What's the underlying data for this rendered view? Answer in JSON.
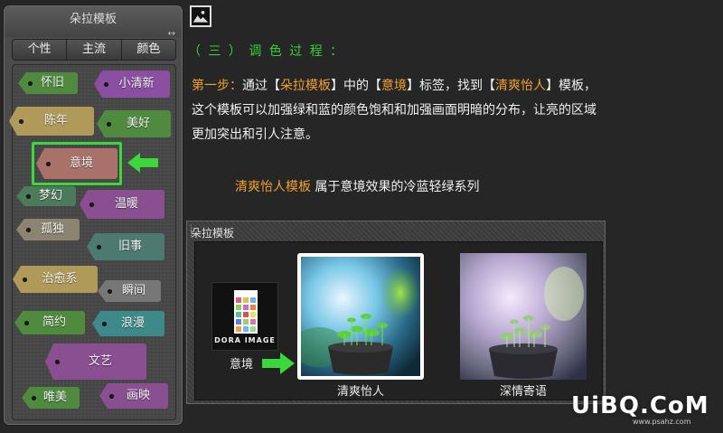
{
  "panel": {
    "title": "朵拉模板",
    "resize_glyph": "↔",
    "tabs": [
      "个性",
      "主流",
      "颜色"
    ],
    "tags": [
      {
        "label": "怀旧",
        "color": "#4f8a3e"
      },
      {
        "label": "小清新",
        "color": "#8a4fa0"
      },
      {
        "label": "陈年",
        "color": "#b09a5a"
      },
      {
        "label": "美好",
        "color": "#4f8a3e"
      },
      {
        "label": "意境",
        "color": "#a8716a"
      },
      {
        "label": "梦幻",
        "color": "#4d7a5a"
      },
      {
        "label": "温暖",
        "color": "#8a4f90"
      },
      {
        "label": "孤独",
        "color": "#8a8470"
      },
      {
        "label": "旧事",
        "color": "#4d7a70"
      },
      {
        "label": "治愈系",
        "color": "#b09a5a"
      },
      {
        "label": "瞬间",
        "color": "#777"
      },
      {
        "label": "简约",
        "color": "#4f8a3e"
      },
      {
        "label": "浪漫",
        "color": "#3e8a8a"
      },
      {
        "label": "文艺",
        "color": "#8a4f90"
      },
      {
        "label": "唯美",
        "color": "#4f8a3e"
      },
      {
        "label": "画映",
        "color": "#8a4f90"
      }
    ]
  },
  "content": {
    "heading": "（ 三 ） 调 色 过 程 ：",
    "step_label": "第一步：",
    "p1_a": "通过【",
    "p1_b": "朵拉模板",
    "p1_c": "】中的【",
    "p1_d": "意境",
    "p1_e": "】标签，找到【",
    "p1_f": "清爽怡人",
    "p1_g": "】模板，",
    "p2": "这个模板可以加强绿和蓝的颜色饱和和加强画面明暗的分布，让亮的区域",
    "p3": "更加突出和引人注意。",
    "caption_hl": "清爽怡人模板",
    "caption_rest": " 属于意境效果的冷蓝轻绿系列"
  },
  "preview": {
    "title": "朵拉模板",
    "logo_text": "DORA IMAGE",
    "logo_label": "意境",
    "thumb1_label": "清爽怡人",
    "thumb2_label": "深情寄语"
  },
  "watermark": {
    "main": "UiBQ.CoM",
    "sub": "www.psahz.com"
  },
  "colors": {
    "accent_green": "#35d235",
    "highlight_orange": "#f0a030",
    "selection_green": "#3ad83a"
  }
}
